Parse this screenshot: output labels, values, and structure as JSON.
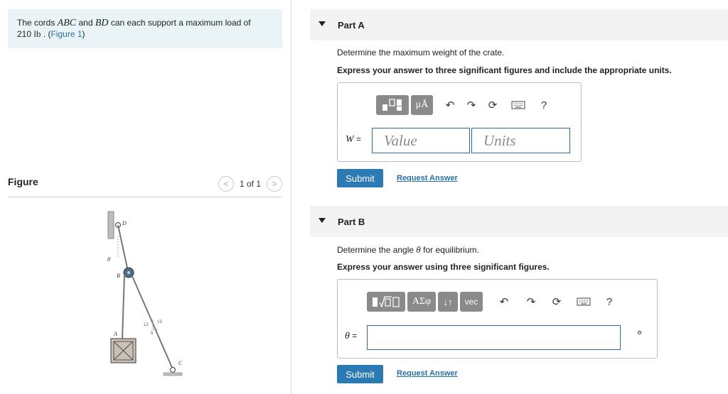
{
  "problem": {
    "text_1": "The cords ",
    "cord_abc": "ABC",
    "text_2": " and ",
    "cord_bd": "BD",
    "text_3": " can each support a maximum load of",
    "load_value": "210",
    "load_unit": "lb",
    "text_4": " . (",
    "figure_link": "Figure 1",
    "text_5": ")"
  },
  "figure_panel": {
    "title": "Figure",
    "pager_prev": "<",
    "pager_text": "1 of 1",
    "pager_next": ">",
    "labels": {
      "d": "D",
      "theta": "θ",
      "b": "B",
      "a": "A",
      "c": "C",
      "n12": "12",
      "n5": "5",
      "n13": "13"
    }
  },
  "part_a": {
    "label": "Part A",
    "question": "Determine the maximum weight of the crate.",
    "instruction": "Express your answer to three significant figures and include the appropriate units.",
    "var_label": "W",
    "equals": " =",
    "value_placeholder": "Value",
    "units_placeholder": "Units",
    "toolbar": {
      "units_btn": "μÅ",
      "help": "?"
    },
    "submit": "Submit",
    "request": "Request Answer"
  },
  "part_b": {
    "label": "Part B",
    "question_1": "Determine the angle ",
    "question_var": "θ",
    "question_2": " for equilibrium.",
    "instruction": "Express your answer using three significant figures.",
    "var_label": "θ",
    "equals": " =",
    "toolbar": {
      "greek_btn": "ΑΣφ",
      "arrows_btn": "↓↑",
      "vec_btn": "vec",
      "help": "?"
    },
    "submit": "Submit",
    "request": "Request Answer"
  },
  "colors": {
    "accent": "#2b7ab3",
    "problem_bg": "#eaf3f6",
    "header_bg": "#f3f3f3"
  }
}
